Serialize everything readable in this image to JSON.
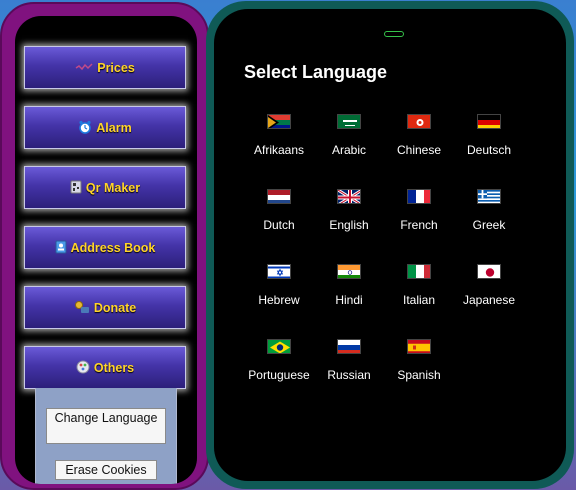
{
  "sidebar": {
    "items": [
      {
        "label": "Prices",
        "icon": "prices-icon"
      },
      {
        "label": "Alarm",
        "icon": "alarm-clock-icon"
      },
      {
        "label": "Qr Maker",
        "icon": "qr-maker-icon"
      },
      {
        "label": "Address Book",
        "icon": "address-book-icon"
      },
      {
        "label": "Donate",
        "icon": "donate-icon"
      },
      {
        "label": "Others",
        "icon": "others-icon"
      }
    ],
    "submenu": {
      "change_language": "Change Language",
      "erase_cookies": "Erase Cookies"
    }
  },
  "main": {
    "title": "Select Language",
    "languages": [
      {
        "name": "Afrikaans",
        "flag": "south-africa-flag"
      },
      {
        "name": "Arabic",
        "flag": "saudi-arabia-flag"
      },
      {
        "name": "Chinese",
        "flag": "hong-kong-flag"
      },
      {
        "name": "Deutsch",
        "flag": "germany-flag"
      },
      {
        "name": "Dutch",
        "flag": "netherlands-flag"
      },
      {
        "name": "English",
        "flag": "uk-flag"
      },
      {
        "name": "French",
        "flag": "france-flag"
      },
      {
        "name": "Greek",
        "flag": "greece-flag"
      },
      {
        "name": "Hebrew",
        "flag": "israel-flag"
      },
      {
        "name": "Hindi",
        "flag": "india-flag"
      },
      {
        "name": "Italian",
        "flag": "italy-flag"
      },
      {
        "name": "Japanese",
        "flag": "japan-flag"
      },
      {
        "name": "Portuguese",
        "flag": "brazil-flag"
      },
      {
        "name": "Russian",
        "flag": "russia-flag"
      },
      {
        "name": "Spanish",
        "flag": "spain-flag"
      }
    ]
  },
  "colors": {
    "left_phone_frame": "#80127f",
    "right_phone_frame": "#0f5a56",
    "button_label": "#ffd42a",
    "button_gradient_top": "#6a5ad8",
    "button_gradient_bottom": "#2c1f7a",
    "submenu_bg": "#8ea1c6",
    "notch_outline": "#35c24a"
  }
}
